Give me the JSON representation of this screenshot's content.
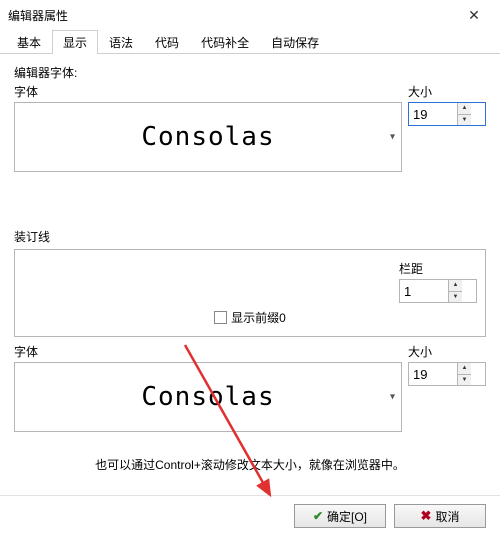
{
  "window": {
    "title": "编辑器属性"
  },
  "tabs": [
    "基本",
    "显示",
    "语法",
    "代码",
    "代码补全",
    "自动保存"
  ],
  "activeTabIndex": 1,
  "editorFont": {
    "heading": "编辑器字体:",
    "fontLabel": "字体",
    "sizeLabel": "大小",
    "fontName": "Consolas",
    "sizeValue": "19"
  },
  "gutter": {
    "heading": "装订线",
    "marginLabel": "栏距",
    "marginValue": "1",
    "showPrefixLabel": "显示前缀0",
    "fontLabel": "字体",
    "sizeLabel": "大小",
    "fontName": "Consolas",
    "sizeValue": "19"
  },
  "hint": "也可以通过Control+滚动修改文本大小，就像在浏览器中。",
  "buttons": {
    "ok": "确定[O]",
    "cancel": "取消"
  },
  "icons": {
    "close": "✕",
    "chevDown": "▾",
    "up": "▲",
    "down": "▼",
    "check": "✔",
    "cross": "✖"
  }
}
